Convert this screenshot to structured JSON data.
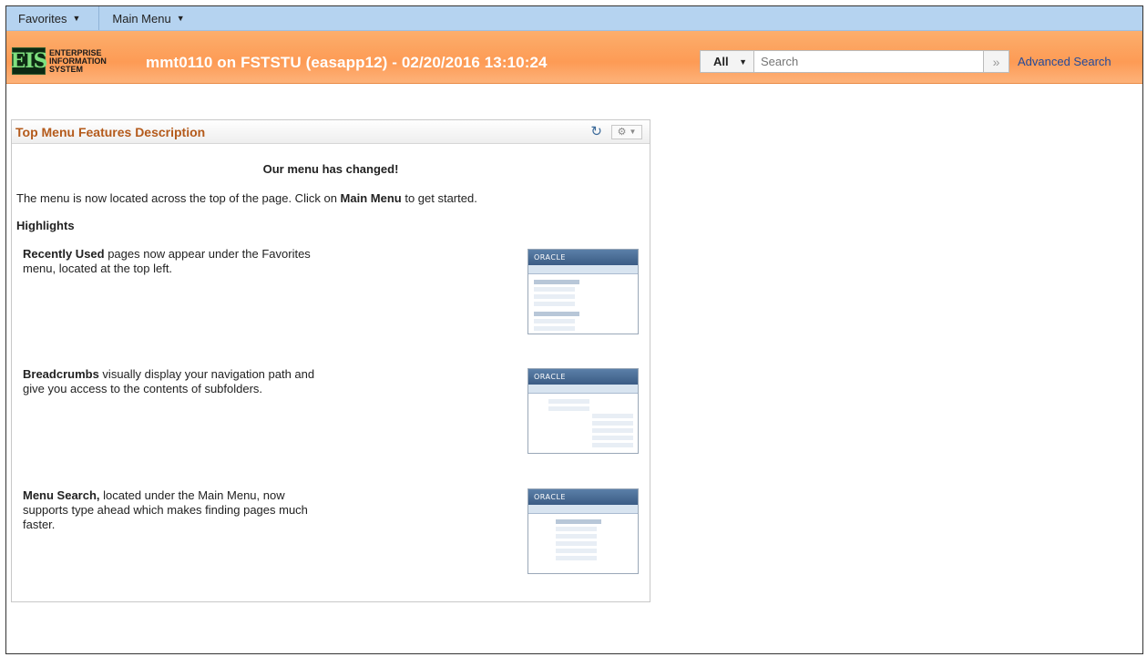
{
  "nav": {
    "favorites_label": "Favorites",
    "main_menu_label": "Main Menu"
  },
  "header": {
    "logo_letters": "EIS",
    "logo_line1": "ENTERPRISE",
    "logo_line2": "INFORMATION",
    "logo_line3": "SYSTEM",
    "session_text": "mmt0110 on FSTSTU (easapp12) - 02/20/2016 13:10:24"
  },
  "search": {
    "category": "All",
    "placeholder": "Search",
    "go_glyph": "»",
    "advanced_label": "Advanced Search"
  },
  "pagelet": {
    "title": "Top Menu Features Description",
    "heading": "Our menu has changed!",
    "intro_prefix": "The menu is now located across the top of the page. Click on ",
    "intro_bold": "Main Menu",
    "intro_suffix": " to get started.",
    "highlights_label": "Highlights",
    "features": [
      {
        "bold": "Recently Used",
        "text": " pages now appear under the Favorites menu, located at the top left."
      },
      {
        "bold": "Breadcrumbs",
        "text": " visually display your navigation path and give you access to the contents of subfolders."
      },
      {
        "bold": "Menu Search,",
        "text": " located under the Main Menu, now supports type ahead which makes finding pages much faster."
      }
    ],
    "thumb_brand": "ORACLE"
  },
  "colors": {
    "nav_bg": "#b5d3f0",
    "banner_orange": "#fd9b55",
    "pagelet_title": "#b45a1b",
    "link_blue": "#234a9a"
  },
  "icons": {
    "refresh": "refresh-icon",
    "gear": "gear-icon",
    "caret": "chevron-down-icon",
    "go": "double-chevron-right-icon"
  }
}
